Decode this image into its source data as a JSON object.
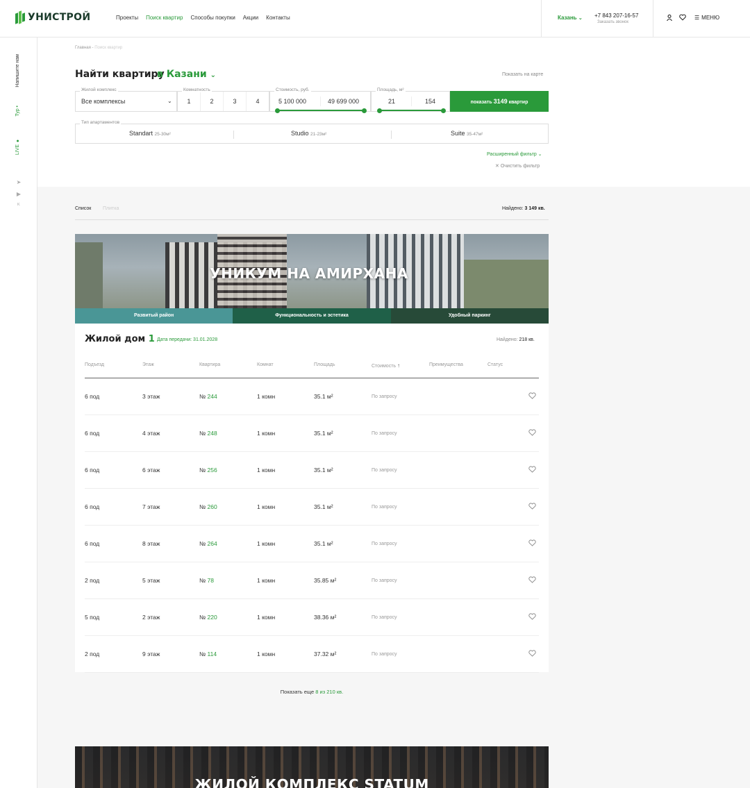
{
  "header": {
    "logo_text": "УНИСТРОЙ",
    "nav": [
      {
        "label": "Проекты",
        "active": false
      },
      {
        "label": "Поиск квартир",
        "active": true
      },
      {
        "label": "Способы покупки",
        "active": false
      },
      {
        "label": "Акции",
        "active": false
      },
      {
        "label": "Контакты",
        "active": false
      }
    ],
    "city": "Казань",
    "phone": "+7 843 207-16-57",
    "callback": "Заказать звонок",
    "menu_label": "МЕНЮ"
  },
  "rail": {
    "write_us": "Напишите нам",
    "tour": "Тур",
    "live": "LIVE",
    "social": [
      "telegram-icon",
      "youtube-icon",
      "vk-icon"
    ]
  },
  "breadcrumb": {
    "home": "Главная",
    "separator": " - ",
    "current": "Поиск квартир"
  },
  "search": {
    "title": "Найти квартиру",
    "city": "в Казани",
    "show_on_map": "Показать на карте",
    "complex_label": "Жилой комплекс",
    "complex_value": "Все комплексы",
    "rooms_label": "Комнатность",
    "rooms": [
      "1",
      "2",
      "3",
      "4"
    ],
    "price_label": "Стоимость, руб.",
    "price_min": "5 100 000",
    "price_max": "49 699 000",
    "area_label": "Площадь, м²",
    "area_min": "21",
    "area_max": "154",
    "button_prefix": "показать",
    "button_count": "3149",
    "button_suffix": "квартир",
    "apt_type_label": "Тип апартаментов",
    "apt_types": [
      {
        "name": "Standart",
        "range": "25-30м²"
      },
      {
        "name": "Studio",
        "range": "21-23м²"
      },
      {
        "name": "Suite",
        "range": "35-47м²"
      }
    ],
    "extended_filter": "Расширенный фильтр",
    "clear_filter": "Очистить фильтр"
  },
  "results": {
    "view_list": "Список",
    "view_tiles": "Плитка",
    "found_label": "Найдено:",
    "found_value": "3 149 кв."
  },
  "project": {
    "banner_title": "УНИКУМ НА АМИРХАНА",
    "tags": [
      {
        "label": "Развитый район",
        "color": "#4a9696"
      },
      {
        "label": "Функциональность и эстетика",
        "color": "#1f6048"
      },
      {
        "label": "Удобный паркинг",
        "color": "#274a38"
      }
    ],
    "house_label": "Жилой дом",
    "house_number": "1",
    "handover_label": "Дата передачи:",
    "handover_date": "31.01.2028",
    "found_label": "Найдено:",
    "found_value": "218 кв.",
    "columns": [
      "Подъезд",
      "Этаж",
      "Квартира",
      "Комнат",
      "Площадь",
      "Стоимость",
      "Преимущества",
      "Статус"
    ],
    "rows": [
      {
        "entrance": "6 под",
        "floor": "3 этаж",
        "apt_prefix": "№",
        "apt": "244",
        "rooms": "1 комн",
        "area": "35.1 м²",
        "price": "По запросу"
      },
      {
        "entrance": "6 под",
        "floor": "4 этаж",
        "apt_prefix": "№",
        "apt": "248",
        "rooms": "1 комн",
        "area": "35.1 м²",
        "price": "По запросу"
      },
      {
        "entrance": "6 под",
        "floor": "6 этаж",
        "apt_prefix": "№",
        "apt": "256",
        "rooms": "1 комн",
        "area": "35.1 м²",
        "price": "По запросу"
      },
      {
        "entrance": "6 под",
        "floor": "7 этаж",
        "apt_prefix": "№",
        "apt": "260",
        "rooms": "1 комн",
        "area": "35.1 м²",
        "price": "По запросу"
      },
      {
        "entrance": "6 под",
        "floor": "8 этаж",
        "apt_prefix": "№",
        "apt": "264",
        "rooms": "1 комн",
        "area": "35.1 м²",
        "price": "По запросу"
      },
      {
        "entrance": "2 под",
        "floor": "5 этаж",
        "apt_prefix": "№",
        "apt": "78",
        "rooms": "1 комн",
        "area": "35.85 м²",
        "price": "По запросу"
      },
      {
        "entrance": "5 под",
        "floor": "2 этаж",
        "apt_prefix": "№",
        "apt": "220",
        "rooms": "1 комн",
        "area": "38.36 м²",
        "price": "По запросу"
      },
      {
        "entrance": "2 под",
        "floor": "9 этаж",
        "apt_prefix": "№",
        "apt": "114",
        "rooms": "1 комн",
        "area": "37.32 м²",
        "price": "По запросу"
      }
    ],
    "show_more_prefix": "Показать еще",
    "show_more_count": "8 из 210 кв."
  },
  "project2": {
    "banner_title": "ЖИЛОЙ КОМПЛЕКС STATUM"
  },
  "colors": {
    "accent": "#2a9a3a"
  }
}
